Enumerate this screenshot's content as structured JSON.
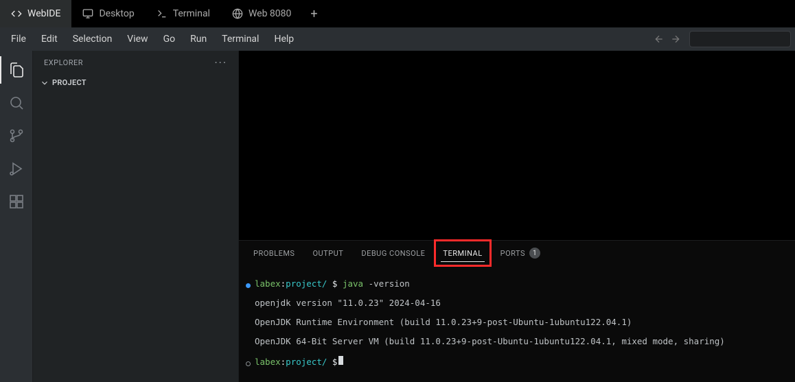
{
  "topTabs": {
    "items": [
      {
        "label": "WebIDE",
        "icon": "code-icon"
      },
      {
        "label": "Desktop",
        "icon": "desktop-icon"
      },
      {
        "label": "Terminal",
        "icon": "terminal-icon"
      },
      {
        "label": "Web 8080",
        "icon": "globe-icon"
      }
    ],
    "activeIndex": 0
  },
  "menu": {
    "items": [
      "File",
      "Edit",
      "Selection",
      "View",
      "Go",
      "Run",
      "Terminal",
      "Help"
    ]
  },
  "sidebar": {
    "title": "EXPLORER",
    "project": "PROJECT"
  },
  "panel": {
    "tabs": [
      "PROBLEMS",
      "OUTPUT",
      "DEBUG CONSOLE",
      "TERMINAL",
      "PORTS"
    ],
    "activeIndex": 3,
    "portsBadge": "1"
  },
  "terminal": {
    "user": "labex",
    "cwd": "project/",
    "promptSymbol": "$",
    "command": "java",
    "commandArgs": "-version",
    "outputLines": [
      "openjdk version \"11.0.23\" 2024-04-16",
      "OpenJDK Runtime Environment (build 11.0.23+9-post-Ubuntu-1ubuntu122.04.1)",
      "OpenJDK 64-Bit Server VM (build 11.0.23+9-post-Ubuntu-1ubuntu122.04.1, mixed mode, sharing)"
    ]
  }
}
